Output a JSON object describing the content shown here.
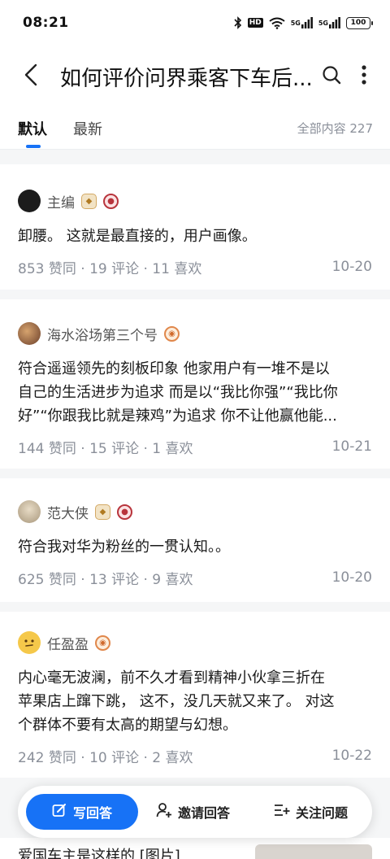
{
  "status_bar": {
    "time": "08:21",
    "hd_label": "HD",
    "net1": "5G",
    "net2": "5G",
    "battery": "100"
  },
  "header": {
    "title": "如何评价问界乘客下车后..."
  },
  "tabs": {
    "default_label": "默认",
    "latest_label": "最新",
    "count_label": "全部内容 227"
  },
  "answers": [
    {
      "author": "主编",
      "content": "卸腰。 这就是最直接的，用户画像。",
      "stats": "853  赞同 · 19  评论 · 11  喜欢",
      "date": "10-20",
      "avatar_color": "#1c1c1c"
    },
    {
      "author": "海水浴场第三个号",
      "content_lines": [
        "符合遥遥领先的刻板印象 他家用户有一堆不是以",
        "自己的生活进步为追求 而是以“我比你强”“我比你",
        "好”“你跟我比就是辣鸡”为追求 你不让他赢他能..."
      ],
      "stats": "144  赞同 · 15  评论 · 1  喜欢",
      "date": "10-21",
      "avatar_color": "#8d6b52"
    },
    {
      "author": "范大侠",
      "content": "符合我对华为粉丝的一贯认知。。",
      "stats": "625  赞同 · 13  评论 · 9  喜欢",
      "date": "10-20",
      "avatar_color": "#cbbfa8"
    },
    {
      "author": "任盈盈",
      "content_lines": [
        "内心毫无波澜，前不久才看到精神小伙拿三折在",
        "苹果店上蹿下跳， 这不，没几天就又来了。 对这",
        "个群体不要有太高的期望与幻想。"
      ],
      "stats": "242  赞同 · 10  评论 · 2  喜欢",
      "date": "10-22",
      "avatar_color": "#f5c84a"
    }
  ],
  "peek": {
    "text": "爱国车主是这样的 [图片]"
  },
  "action_bar": {
    "write_label": "写回答",
    "invite_label": "邀请回答",
    "follow_label": "关注问题"
  },
  "colors": {
    "accent": "#1772f6",
    "muted": "#8a8f99"
  },
  "icons": [
    "back-arrow-icon",
    "search-icon",
    "more-vertical-icon",
    "edit-icon",
    "person-add-icon",
    "follow-list-icon"
  ]
}
